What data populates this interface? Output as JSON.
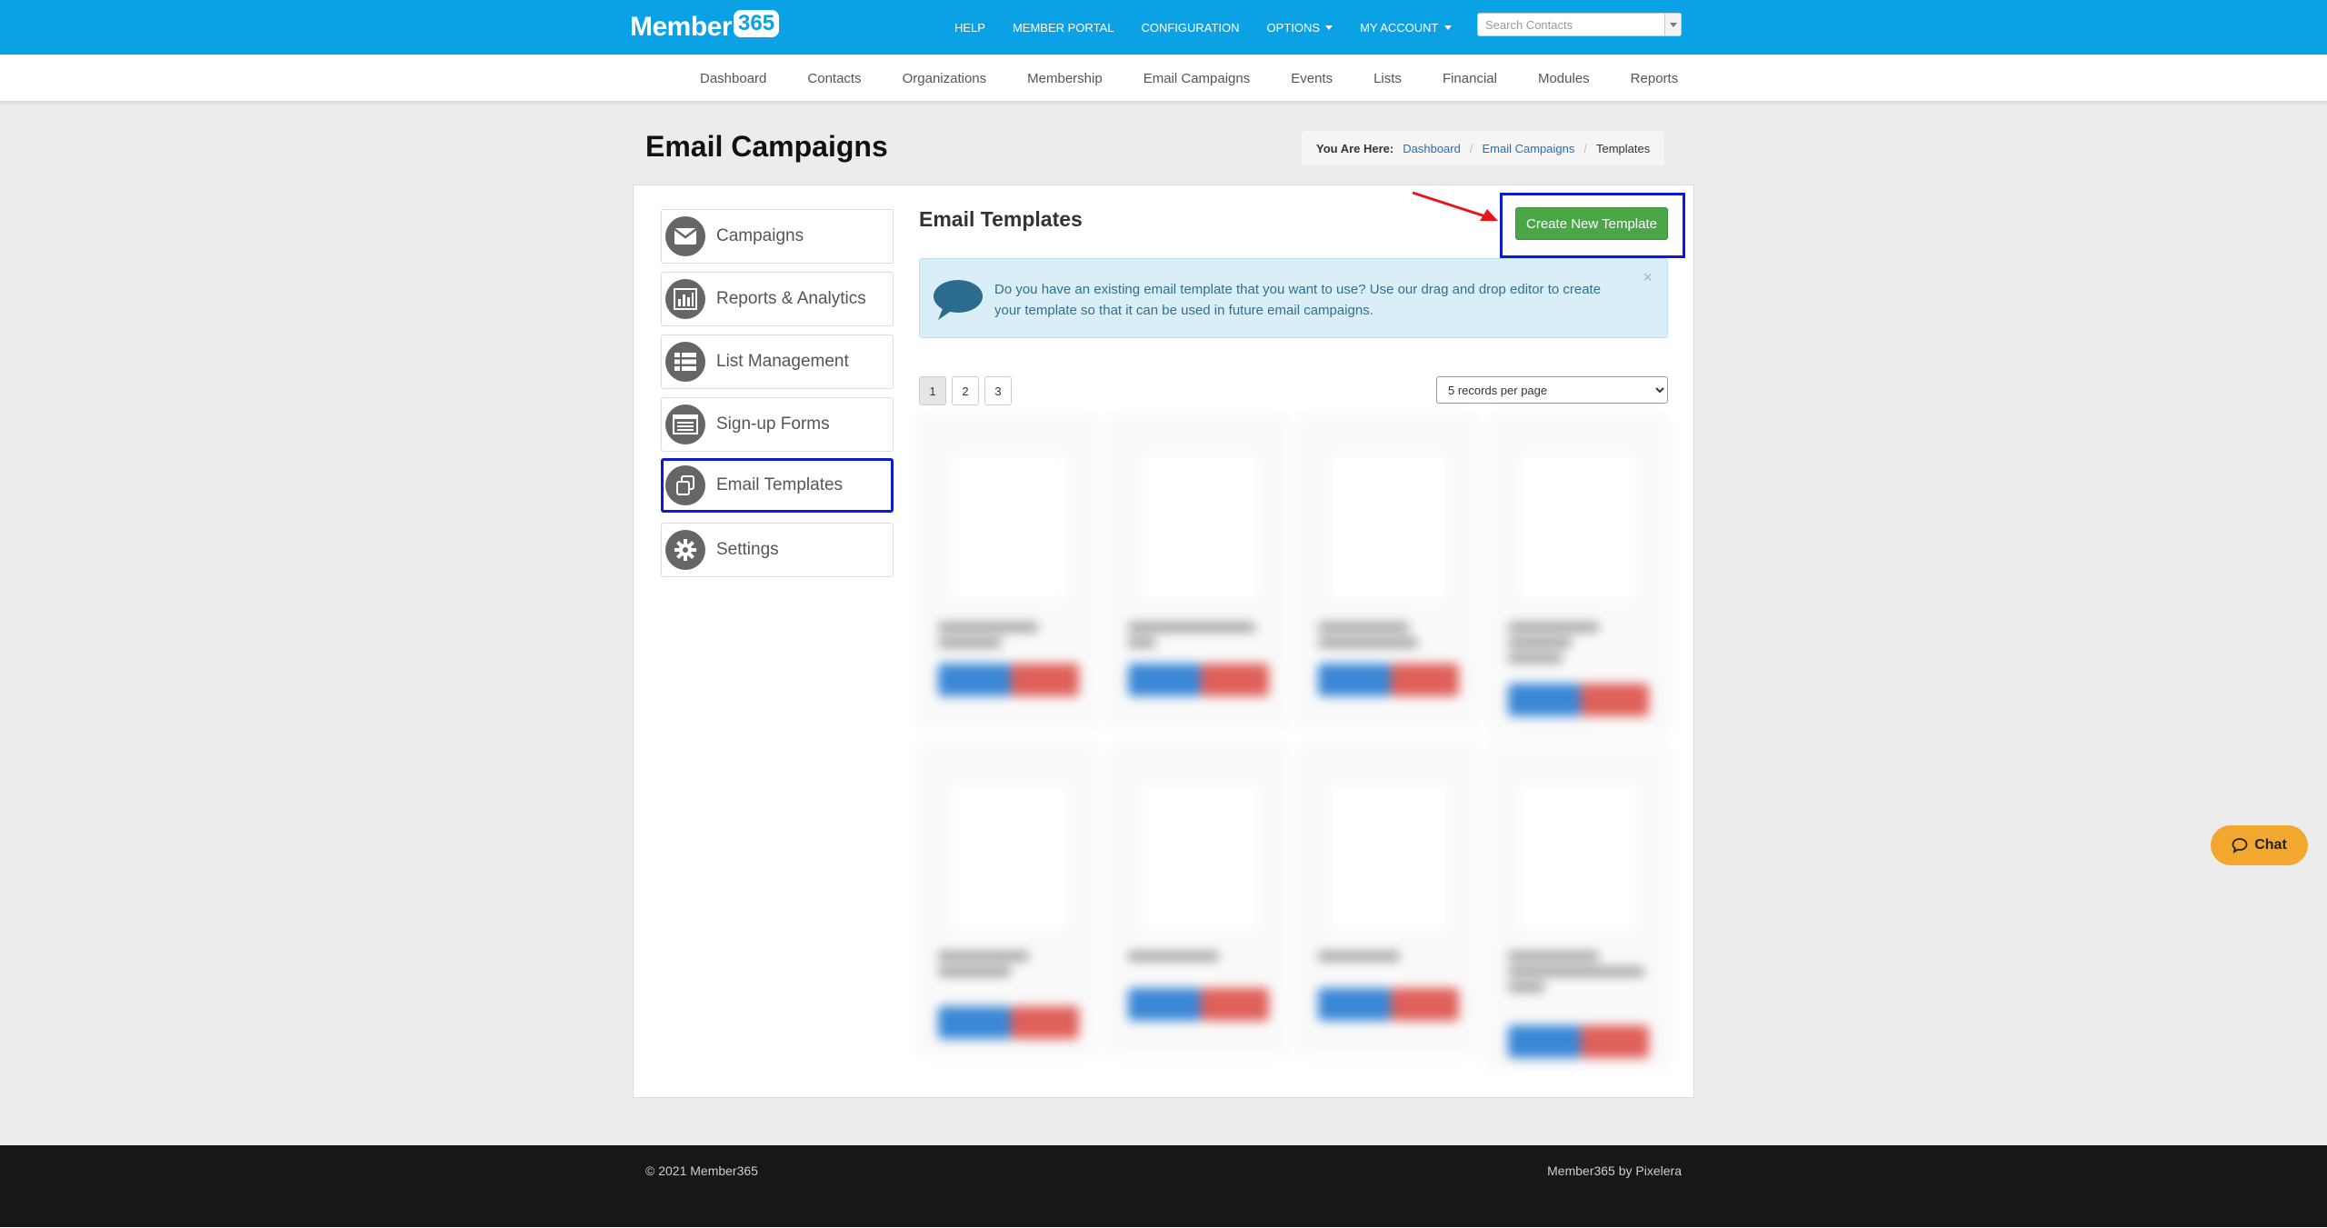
{
  "header": {
    "logo_text": "Member",
    "logo_badge": "365",
    "nav": [
      {
        "label": "HELP"
      },
      {
        "label": "MEMBER PORTAL"
      },
      {
        "label": "CONFIGURATION"
      },
      {
        "label": "OPTIONS"
      },
      {
        "label": "MY ACCOUNT"
      }
    ],
    "search_placeholder": "Search Contacts"
  },
  "main_nav": [
    "Dashboard",
    "Contacts",
    "Organizations",
    "Membership",
    "Email Campaigns",
    "Events",
    "Lists",
    "Financial",
    "Modules",
    "Reports"
  ],
  "page": {
    "title": "Email Campaigns",
    "breadcrumb": {
      "label": "You Are Here:",
      "items": [
        "Dashboard",
        "Email Campaigns"
      ],
      "current": "Templates"
    }
  },
  "sidebar": {
    "items": [
      {
        "label": "Campaigns",
        "icon": "envelope-icon"
      },
      {
        "label": "Reports & Analytics",
        "icon": "bar-chart-icon"
      },
      {
        "label": "List Management",
        "icon": "list-icon"
      },
      {
        "label": "Sign-up Forms",
        "icon": "form-icon"
      },
      {
        "label": "Email Templates",
        "icon": "copy-icon",
        "active": true
      },
      {
        "label": "Settings",
        "icon": "gear-icon"
      }
    ]
  },
  "content": {
    "title": "Email Templates",
    "create_button": "Create New Template",
    "info_text": "Do you have an existing email template that you want to use? Use our drag and drop editor to create your template so that it can be used in future email campaigns.",
    "close_glyph": "×",
    "pages": [
      "1",
      "2",
      "3"
    ],
    "current_page": "1",
    "per_page": "5 records per page"
  },
  "chat_label": "Chat",
  "footer": {
    "copyright": "© 2021 Member365",
    "credit": "Member365 by Pixelera"
  },
  "colors": {
    "header_bg": "#0aa2e4",
    "create_button": "#4aa647",
    "highlight_box": "#0a1ad6",
    "annotation_arrow": "#e8141b",
    "chat_bg": "#f2a830",
    "footer_bg": "#171717"
  }
}
